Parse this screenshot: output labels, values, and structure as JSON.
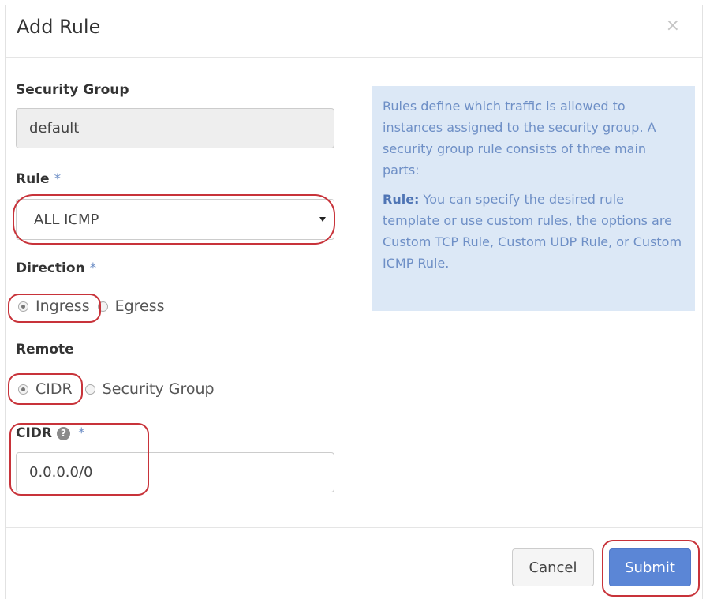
{
  "dialog": {
    "title": "Add Rule",
    "close_glyph": "×"
  },
  "form": {
    "security_group": {
      "label": "Security Group",
      "value": "default"
    },
    "rule": {
      "label": "Rule",
      "required_mark": "*",
      "selected": "ALL ICMP"
    },
    "direction": {
      "label": "Direction",
      "required_mark": "*",
      "options": [
        {
          "label": "Ingress",
          "checked": true
        },
        {
          "label": "Egress",
          "checked": false
        }
      ]
    },
    "remote": {
      "label": "Remote",
      "options": [
        {
          "label": "CIDR",
          "checked": true
        },
        {
          "label": "Security Group",
          "checked": false
        }
      ]
    },
    "cidr": {
      "label": "CIDR",
      "help_glyph": "?",
      "required_mark": "*",
      "value": "0.0.0.0/0"
    }
  },
  "info": {
    "paragraph1": "Rules define which traffic is allowed to instances assigned to the security group. A security group rule consists of three main parts:",
    "rule_term": "Rule:",
    "rule_desc": " You can specify the desired rule template or use custom rules, the options are Custom TCP Rule, Custom UDP Rule, or Custom ICMP Rule."
  },
  "footer": {
    "cancel_label": "Cancel",
    "submit_label": "Submit"
  },
  "colors": {
    "highlight": "#c8333a",
    "submit_bg": "#5b86d6",
    "info_bg": "#dce8f6",
    "info_text": "#6e8fc6"
  }
}
